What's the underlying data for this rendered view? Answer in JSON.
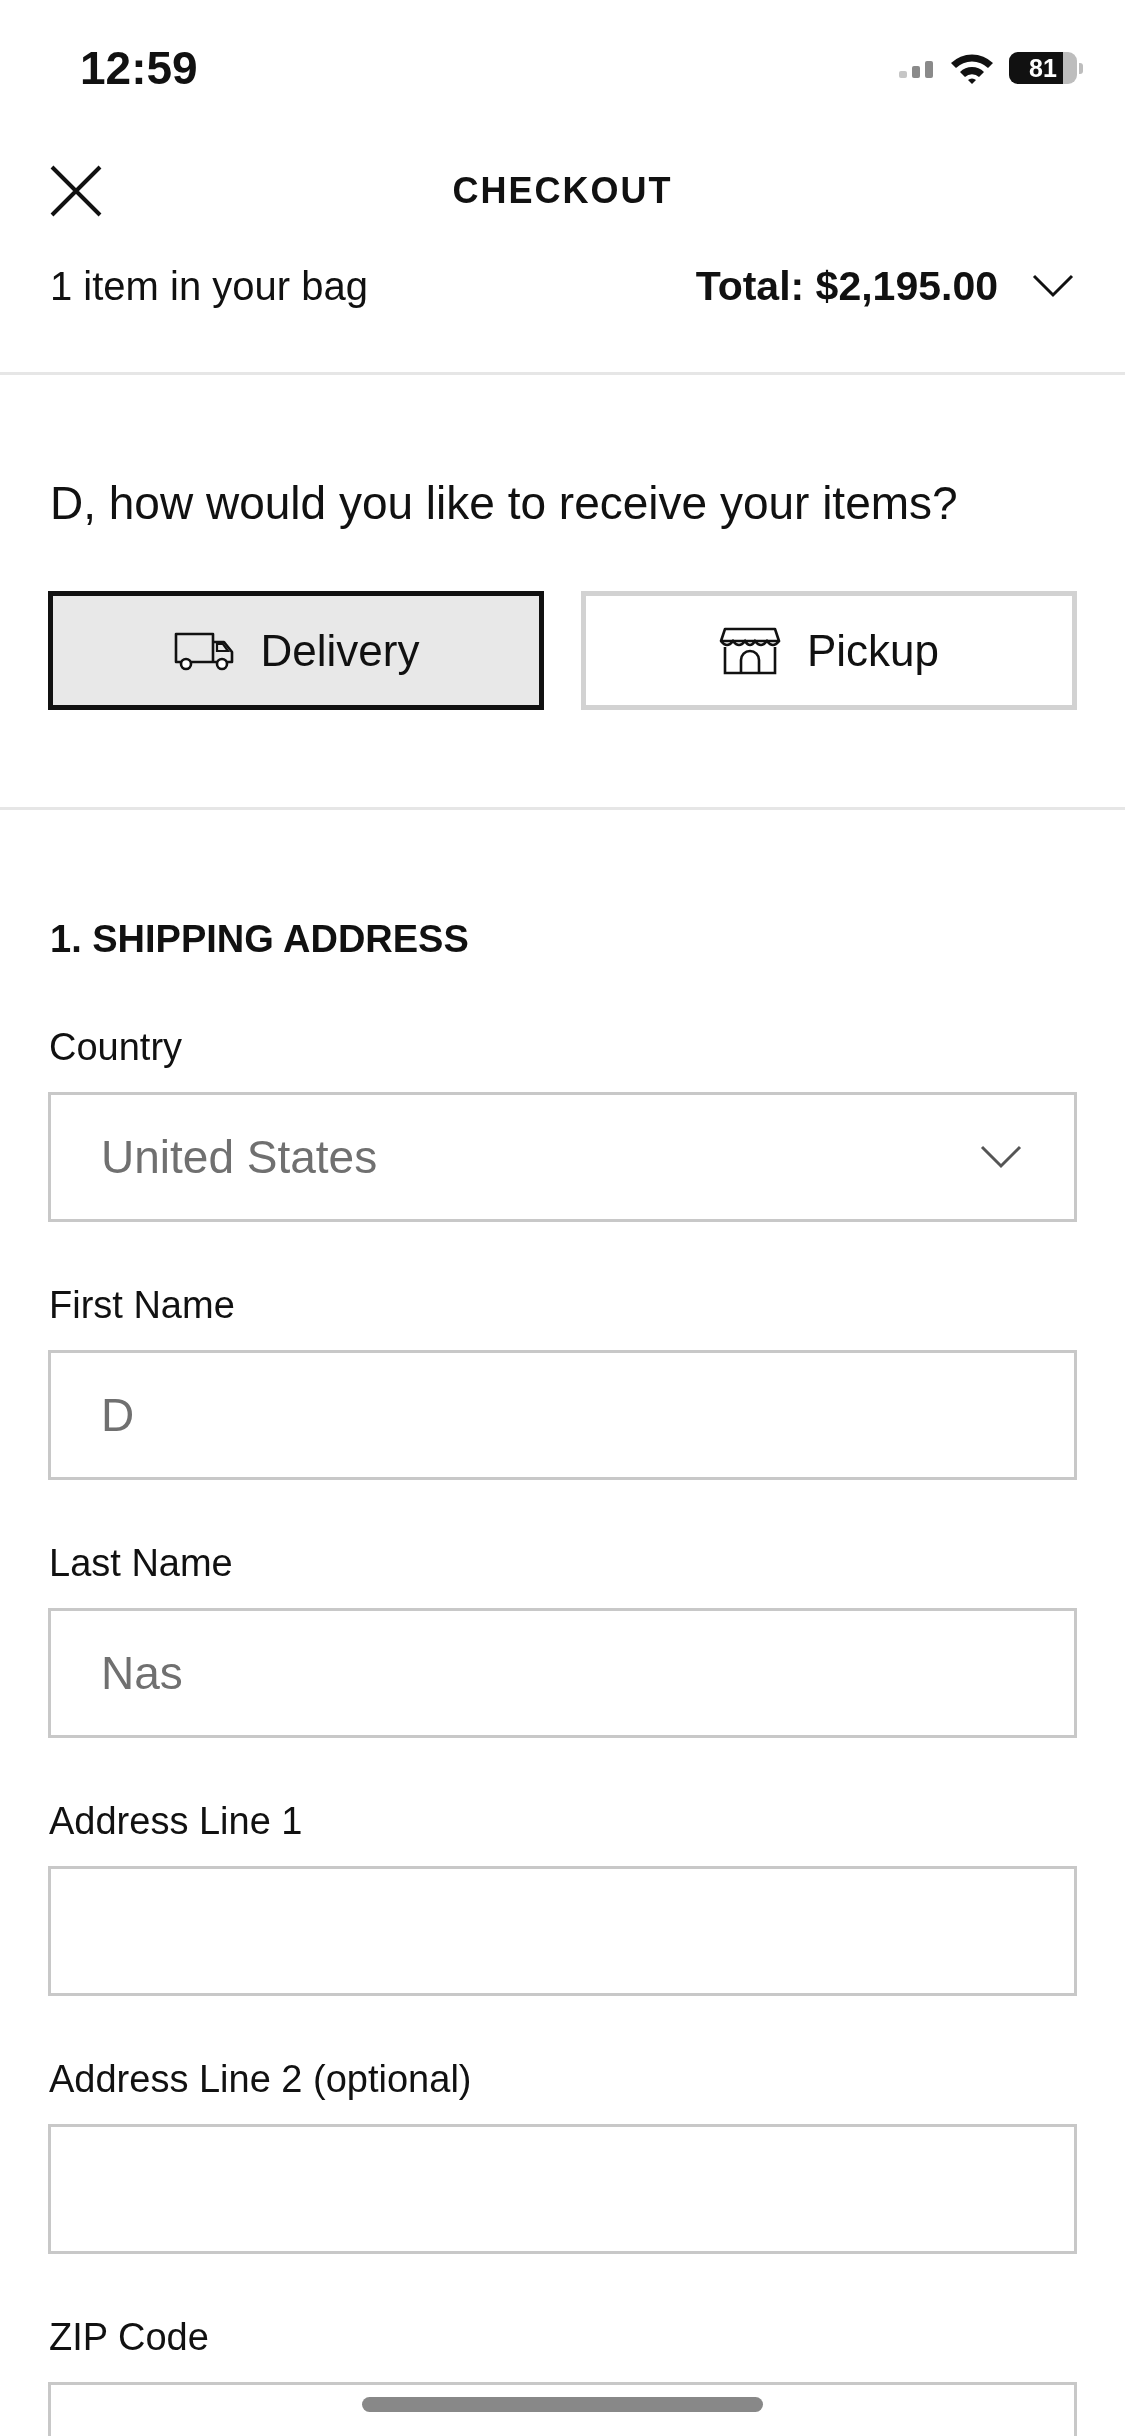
{
  "status_bar": {
    "time": "12:59",
    "battery": "81"
  },
  "header": {
    "title": "CHECKOUT",
    "item_count": "1 item in your bag",
    "total": "Total: $2,195.00",
    "expanded": false
  },
  "receive_options": {
    "question": "D, how would you like to receive your items?",
    "options": [
      {
        "kind": "delivery",
        "label": "Delivery",
        "selected": true
      },
      {
        "kind": "pickup",
        "label": "Pickup",
        "selected": false
      }
    ]
  },
  "shipping_address": {
    "heading": "1. SHIPPING ADDRESS",
    "fields": [
      {
        "kind": "select",
        "label": "Country",
        "value": "United States"
      },
      {
        "kind": "text",
        "label": "First Name",
        "value": "D"
      },
      {
        "kind": "text",
        "label": "Last Name",
        "value": "Nas"
      },
      {
        "kind": "text",
        "label": "Address Line 1"
      },
      {
        "kind": "text",
        "label": "Address Line 2 (optional)"
      },
      {
        "kind": "text",
        "label": "ZIP Code"
      }
    ]
  }
}
